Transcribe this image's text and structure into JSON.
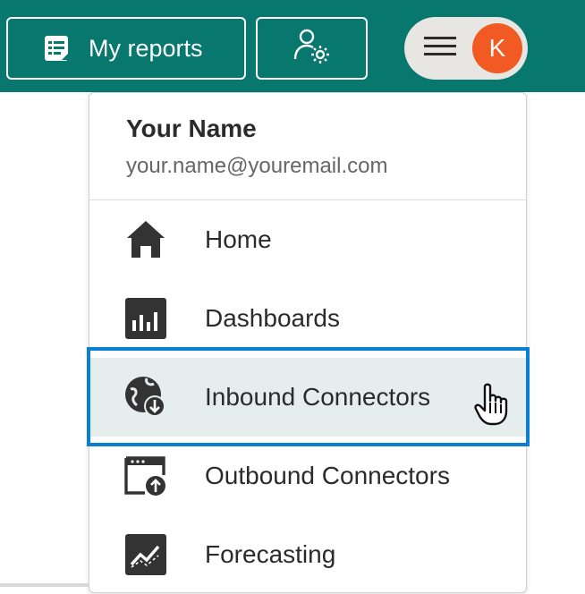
{
  "header": {
    "reports_label": "My reports",
    "avatar_initial": "K"
  },
  "user": {
    "name": "Your Name",
    "email": "your.name@youremail.com"
  },
  "menu": {
    "items": [
      {
        "label": "Home",
        "icon": "home-icon"
      },
      {
        "label": "Dashboards",
        "icon": "dashboards-icon"
      },
      {
        "label": "Inbound Connectors",
        "icon": "inbound-connector-icon"
      },
      {
        "label": "Outbound Connectors",
        "icon": "outbound-connector-icon"
      },
      {
        "label": "Forecasting",
        "icon": "forecasting-icon"
      }
    ],
    "active_index": 2
  },
  "colors": {
    "topbar": "#08776e",
    "avatar": "#f15a22",
    "highlight": "#0a7fd4",
    "active_row": "#e6eeed"
  }
}
